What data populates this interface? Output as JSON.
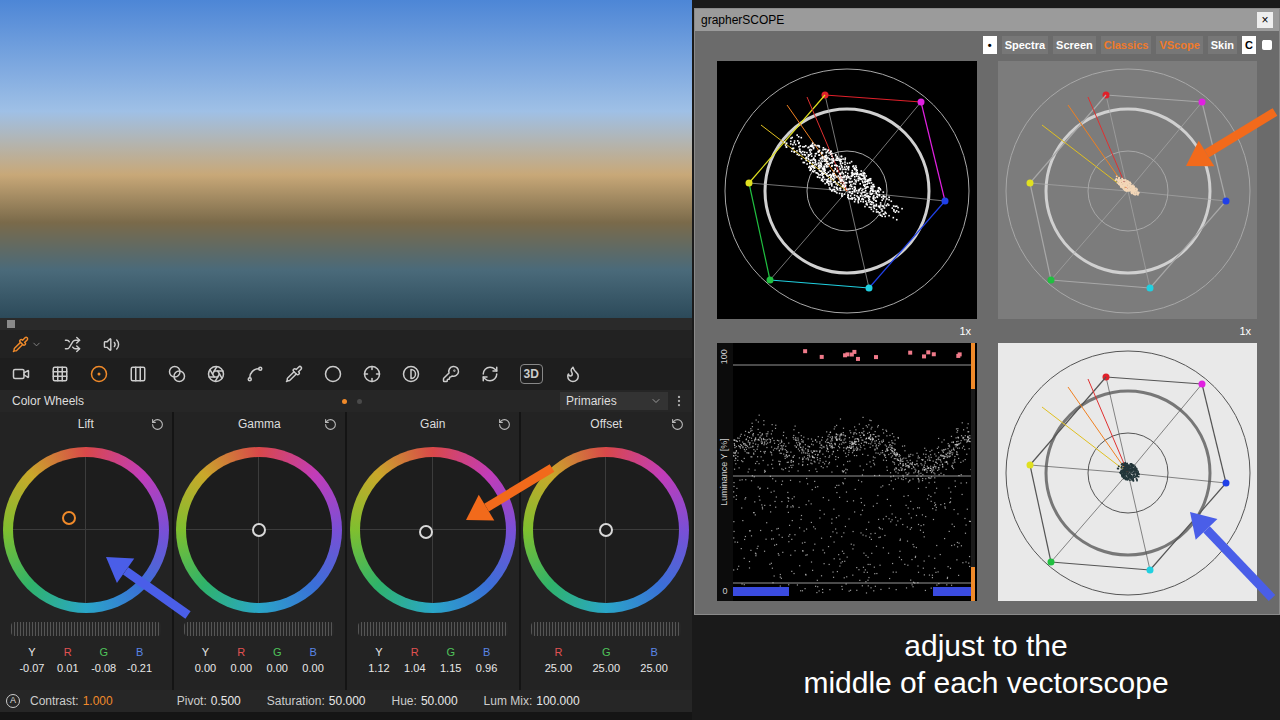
{
  "viewer": {
    "playhead": {
      "level": 0.01
    }
  },
  "page_tools": [
    {
      "selected": false
    },
    {
      "selected": false
    },
    {
      "selected": true
    },
    {
      "selected": false
    },
    {
      "selected": false
    },
    {
      "selected": false
    },
    {
      "selected": false
    },
    {
      "selected": false
    },
    {
      "selected": false
    },
    {
      "selected": false
    },
    {
      "selected": false
    },
    {
      "selected": false
    },
    {
      "selected": false
    },
    {
      "label": "3D",
      "selected": false
    },
    {
      "selected": false
    }
  ],
  "panel": {
    "title": "Color Wheels",
    "pages": [
      {
        "selected": true
      },
      {
        "selected": false
      }
    ],
    "mode": "Primaries"
  },
  "wheels": [
    {
      "title": "Lift",
      "active": true,
      "puck_x": -0.23,
      "puck_y": 0.16,
      "channels": [
        {
          "label": "Y",
          "value": "-0.07",
          "color": "#e6e6e6"
        },
        {
          "label": "R",
          "value": "0.01",
          "color": "#e05252"
        },
        {
          "label": "G",
          "value": "-0.08",
          "color": "#4fc25a"
        },
        {
          "label": "B",
          "value": "-0.21",
          "color": "#5a86e6"
        }
      ]
    },
    {
      "title": "Gamma",
      "active": false,
      "puck_x": 0,
      "puck_y": 0,
      "channels": [
        {
          "label": "Y",
          "value": "0.00",
          "color": "#e6e6e6"
        },
        {
          "label": "R",
          "value": "0.00",
          "color": "#e05252"
        },
        {
          "label": "G",
          "value": "0.00",
          "color": "#4fc25a"
        },
        {
          "label": "B",
          "value": "0.00",
          "color": "#5a86e6"
        }
      ]
    },
    {
      "title": "Gain",
      "active": false,
      "puck_x": -0.09,
      "puck_y": -0.03,
      "channels": [
        {
          "label": "Y",
          "value": "1.12",
          "color": "#e6e6e6"
        },
        {
          "label": "R",
          "value": "1.04",
          "color": "#e05252"
        },
        {
          "label": "G",
          "value": "1.15",
          "color": "#4fc25a"
        },
        {
          "label": "B",
          "value": "0.96",
          "color": "#5a86e6"
        }
      ]
    },
    {
      "title": "Offset",
      "active": false,
      "puck_x": 0,
      "puck_y": 0,
      "channels": [
        {
          "label": "R",
          "value": "25.00",
          "color": "#e05252"
        },
        {
          "label": "G",
          "value": "25.00",
          "color": "#4fc25a"
        },
        {
          "label": "B",
          "value": "25.00",
          "color": "#5a86e6"
        }
      ]
    }
  ],
  "auto_badge": "A",
  "adjustments": [
    {
      "label": "Contrast:",
      "value": "1.000",
      "highlighted": true
    },
    {
      "label": "Pivot:",
      "value": "0.500",
      "highlighted": false
    },
    {
      "label": "Saturation:",
      "value": "50.000",
      "highlighted": false
    },
    {
      "label": "Hue:",
      "value": "50.000",
      "highlighted": false
    },
    {
      "label": "Lum Mix:",
      "value": "100.000",
      "highlighted": false
    }
  ],
  "scope_window": {
    "title": "grapherSCOPE",
    "close": "×",
    "tabs": [
      {
        "label": "•",
        "kind": "box",
        "selected": false
      },
      {
        "label": "Spectra",
        "kind": "tab",
        "selected": false
      },
      {
        "label": "Screen",
        "kind": "tab",
        "selected": false
      },
      {
        "label": "Classics",
        "kind": "tab",
        "selected": true
      },
      {
        "label": "VScope",
        "kind": "tab",
        "selected": true
      },
      {
        "label": "Skin",
        "kind": "tab",
        "selected": false
      },
      {
        "label": "C",
        "kind": "box",
        "selected": false
      }
    ],
    "scopes": [
      {
        "kind": "vectorscope",
        "style": "dark",
        "zoom": "1x"
      },
      {
        "kind": "vectorscope",
        "style": "gray",
        "zoom": "1x"
      },
      {
        "kind": "waveform",
        "axis_top": "100",
        "axis_bottom": "0",
        "axis_title": "Luminance Y [%]"
      },
      {
        "kind": "vectorscope",
        "style": "light"
      }
    ]
  },
  "caption": [
    "adjust to the",
    "middle of each vectorscope"
  ],
  "annotations": [
    {
      "color": "#f26a1b"
    },
    {
      "color": "#f26a1b"
    },
    {
      "color": "#4a5ee8"
    },
    {
      "color": "#4a5ee8"
    }
  ]
}
